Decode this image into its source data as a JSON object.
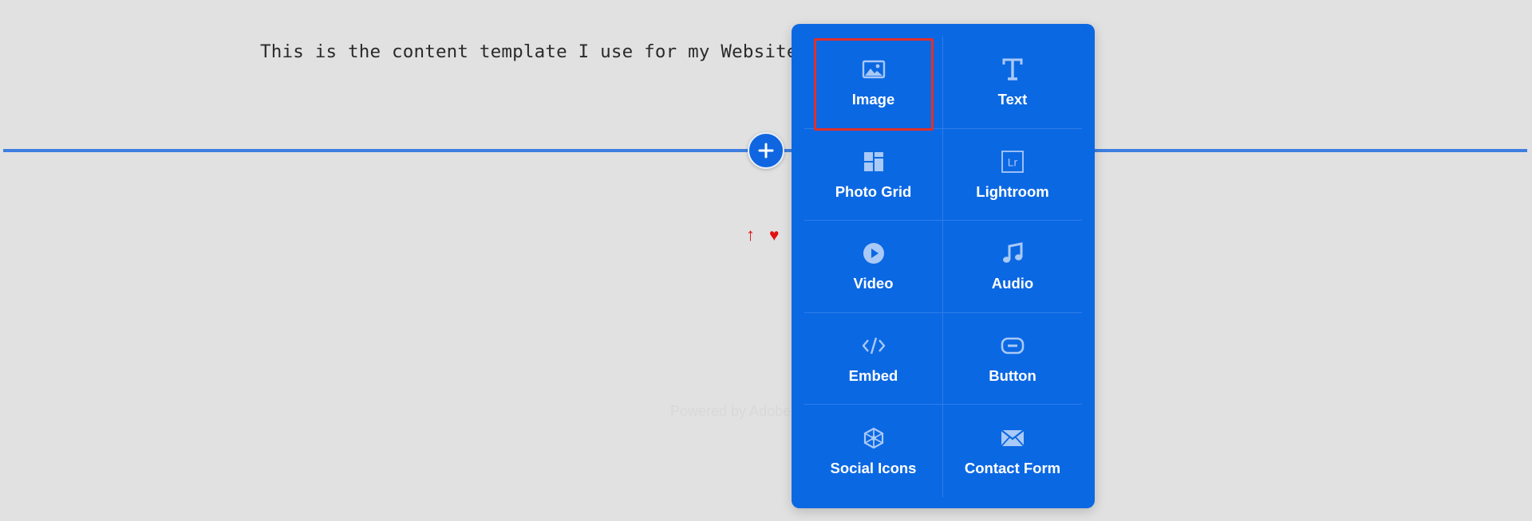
{
  "content": {
    "template_text": "This is the content template I use for my Website:",
    "arrow_mark": "↑",
    "heart_mark": "♥",
    "footer_text": "Powered by Adobe"
  },
  "insert": {
    "add_icon": "plus-icon"
  },
  "block_menu": {
    "selected": "Image",
    "items": [
      {
        "label": "Image",
        "icon": "image-icon"
      },
      {
        "label": "Text",
        "icon": "text-icon"
      },
      {
        "label": "Photo Grid",
        "icon": "photo-grid-icon"
      },
      {
        "label": "Lightroom",
        "icon": "lightroom-icon"
      },
      {
        "label": "Video",
        "icon": "video-icon"
      },
      {
        "label": "Audio",
        "icon": "audio-icon"
      },
      {
        "label": "Embed",
        "icon": "embed-icon"
      },
      {
        "label": "Button",
        "icon": "button-icon"
      },
      {
        "label": "Social Icons",
        "icon": "social-icons-icon"
      },
      {
        "label": "Contact Form",
        "icon": "contact-form-icon"
      }
    ]
  },
  "colors": {
    "background": "#e1e1e1",
    "panel": "#0b68e3",
    "accent_line": "#3d7fe0",
    "highlight": "#e0302a",
    "marker": "#e31010"
  }
}
